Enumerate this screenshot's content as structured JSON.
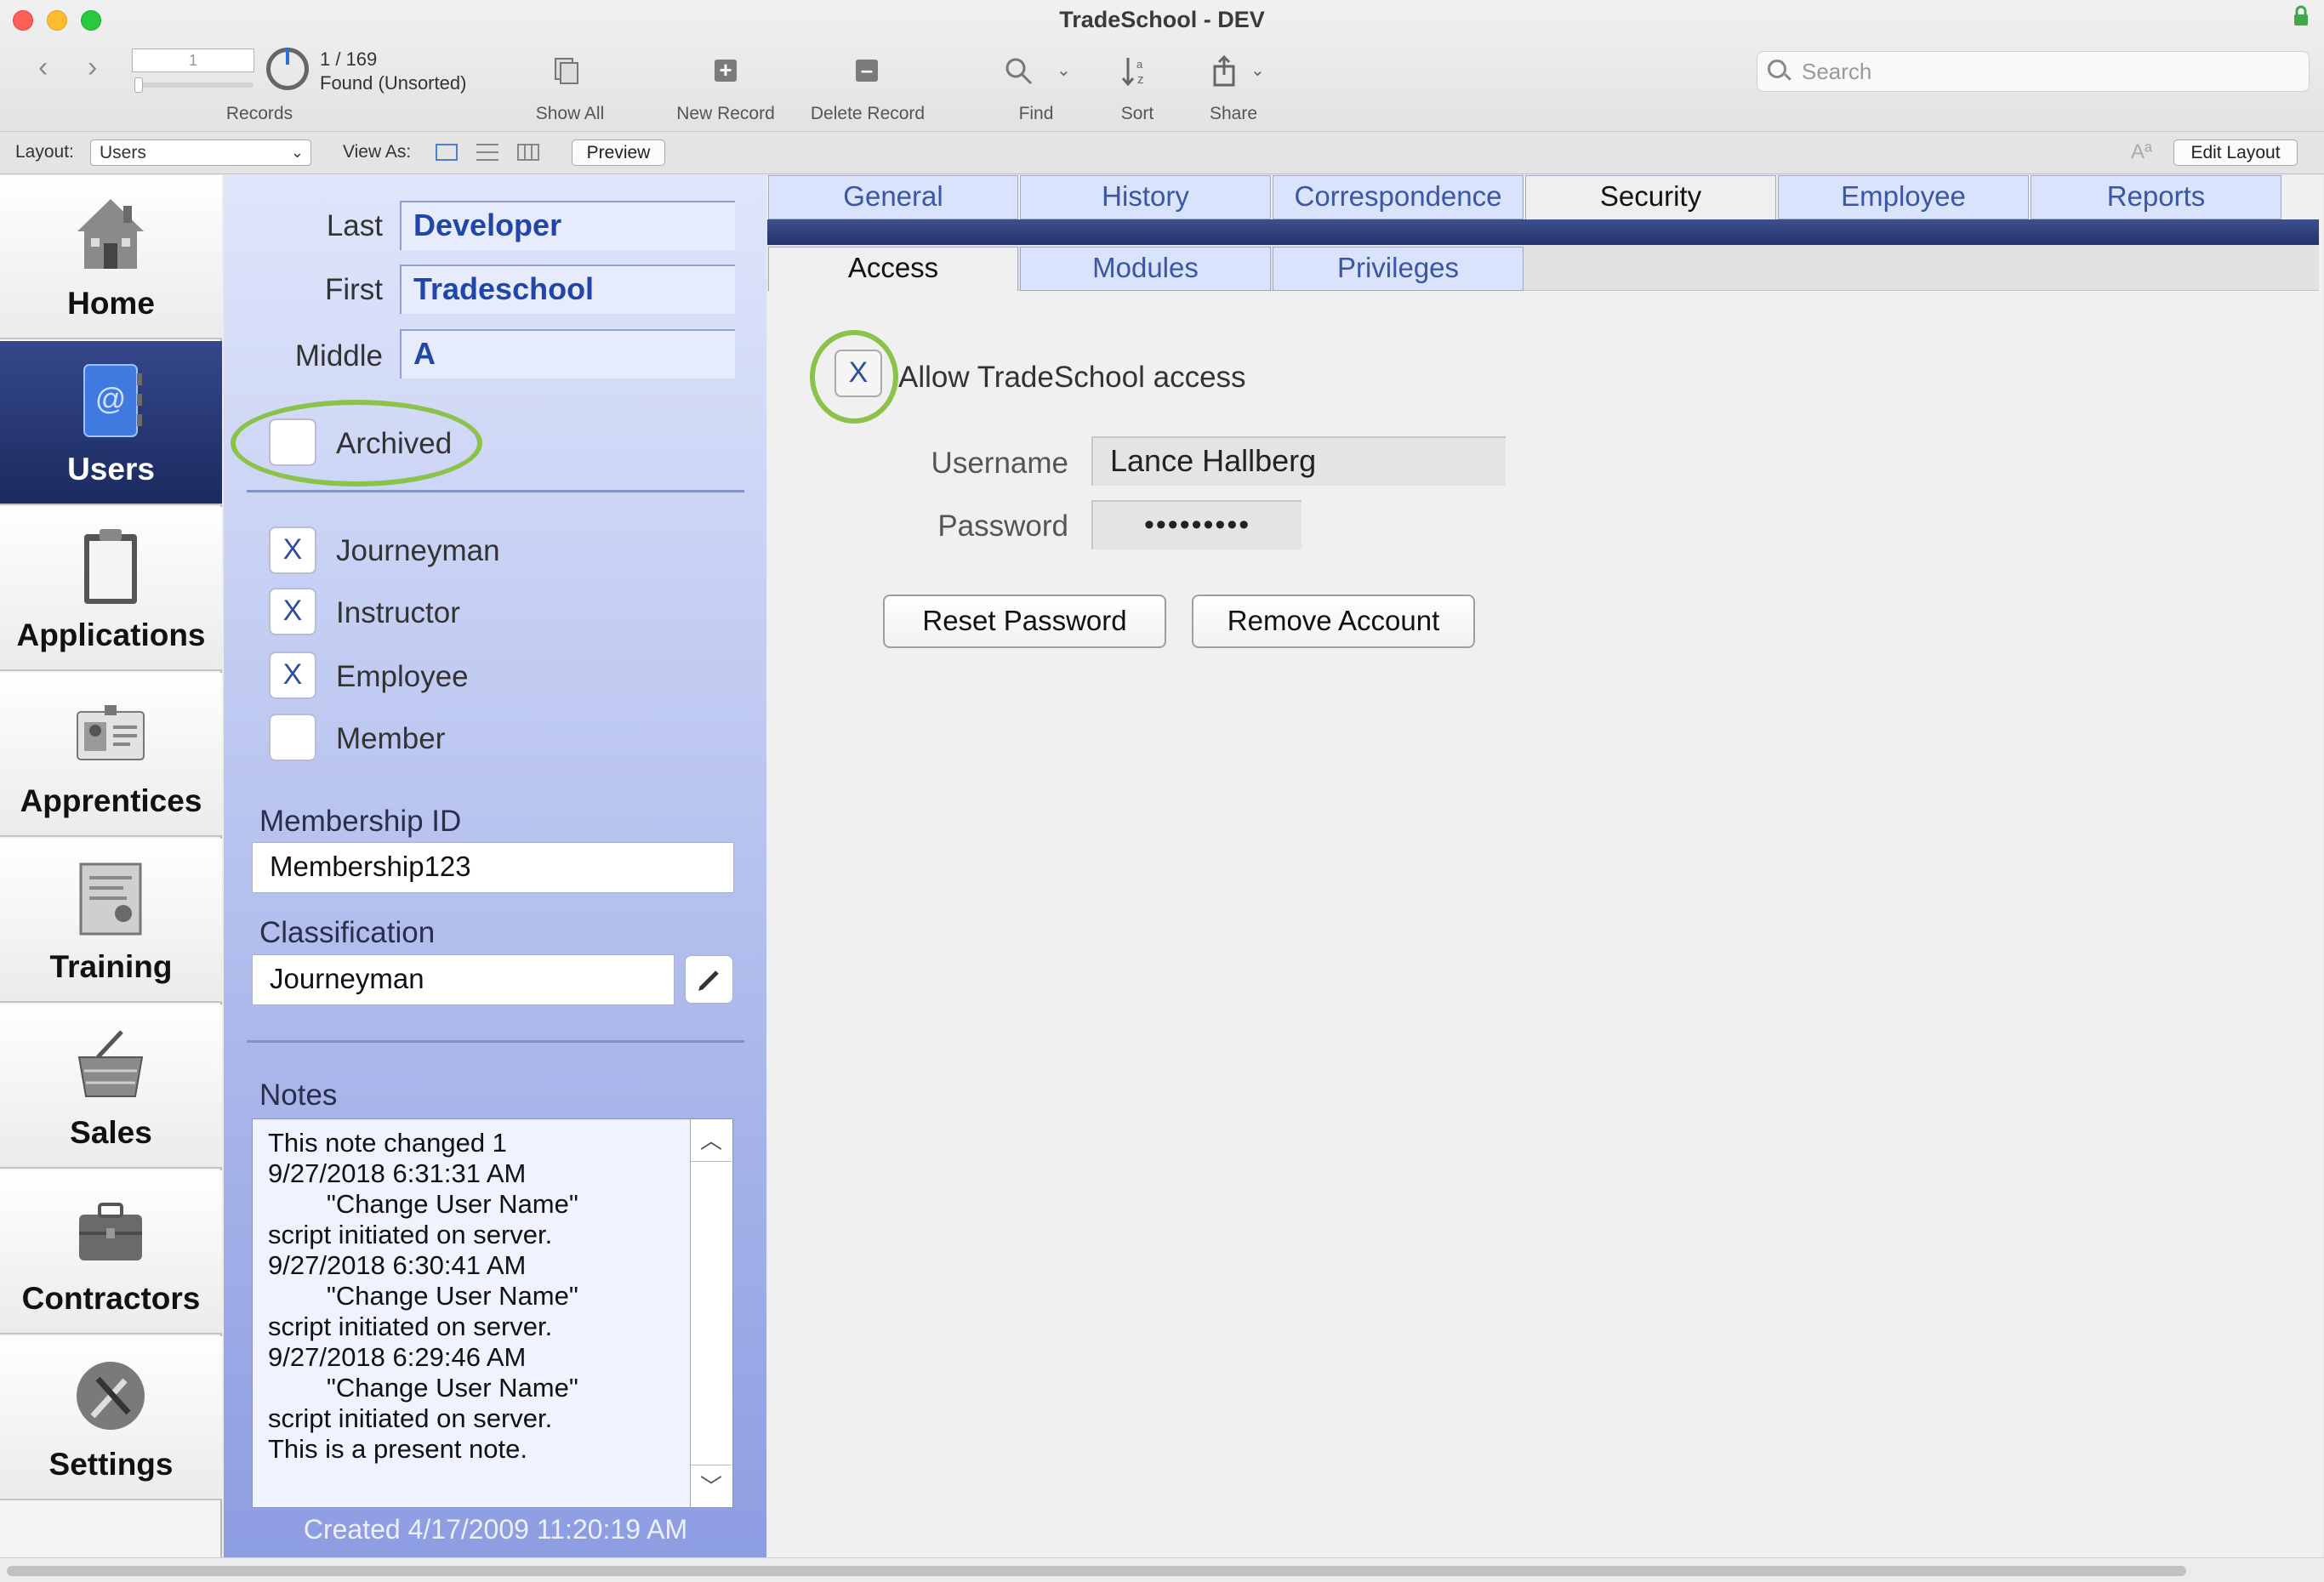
{
  "window": {
    "title": "TradeSchool - DEV"
  },
  "toolbar": {
    "record_number": "1",
    "record_count": "1 / 169",
    "found_status": "Found (Unsorted)",
    "records_label": "Records",
    "show_all_label": "Show All",
    "new_record_label": "New Record",
    "delete_record_label": "Delete Record",
    "find_label": "Find",
    "sort_label": "Sort",
    "share_label": "Share",
    "search_placeholder": "Search"
  },
  "layout_bar": {
    "layout_label": "Layout:",
    "layout_value": "Users",
    "view_as_label": "View As:",
    "preview_label": "Preview",
    "edit_layout_label": "Edit Layout"
  },
  "nav": {
    "items": [
      {
        "label": "Home",
        "icon": "house-icon",
        "active": false
      },
      {
        "label": "Users",
        "icon": "address-book-icon",
        "active": true
      },
      {
        "label": "Applications",
        "icon": "clipboard-icon",
        "active": false
      },
      {
        "label": "Apprentices",
        "icon": "id-card-icon",
        "active": false
      },
      {
        "label": "Training",
        "icon": "certificate-icon",
        "active": false
      },
      {
        "label": "Sales",
        "icon": "basket-icon",
        "active": false
      },
      {
        "label": "Contractors",
        "icon": "briefcase-icon",
        "active": false
      },
      {
        "label": "Settings",
        "icon": "tools-icon",
        "active": false
      }
    ]
  },
  "user": {
    "last_label": "Last",
    "last_value": "Developer",
    "first_label": "First",
    "first_value": "Tradeschool",
    "middle_label": "Middle",
    "middle_value": "A",
    "archived_label": "Archived",
    "archived_checked": "",
    "roles": [
      {
        "label": "Journeyman",
        "mark": "X"
      },
      {
        "label": "Instructor",
        "mark": "X"
      },
      {
        "label": "Employee",
        "mark": "X"
      },
      {
        "label": "Member",
        "mark": ""
      }
    ],
    "membership_id_label": "Membership ID",
    "membership_id_value": "Membership123",
    "classification_label": "Classification",
    "classification_value": "Journeyman",
    "notes_label": "Notes",
    "notes_value": "This note changed 1\n9/27/2018 6:31:31 AM\n        \"Change User Name\"\nscript initiated on server.\n9/27/2018 6:30:41 AM\n        \"Change User Name\"\nscript initiated on server.\n9/27/2018 6:29:46 AM\n        \"Change User Name\"\nscript initiated on server.\nThis is a present note.",
    "created_text": "Created 4/17/2009 11:20:19 AM"
  },
  "tabs": {
    "main": [
      "General",
      "History",
      "Correspondence",
      "Security",
      "Employee",
      "Reports"
    ],
    "active_main": "Security",
    "sub": [
      "Access",
      "Modules",
      "Privileges"
    ],
    "active_sub": "Access"
  },
  "security": {
    "allow_access_mark": "X",
    "allow_access_label": "Allow TradeSchool access",
    "username_label": "Username",
    "username_value": "Lance Hallberg",
    "password_label": "Password",
    "password_value": "•••••••••",
    "reset_password_label": "Reset Password",
    "remove_account_label": "Remove Account"
  },
  "colors": {
    "highlight_ring": "#8bc34a",
    "active_nav": "#1f2e66",
    "tab_text": "#3a56a5",
    "field_text": "#2146a8"
  }
}
